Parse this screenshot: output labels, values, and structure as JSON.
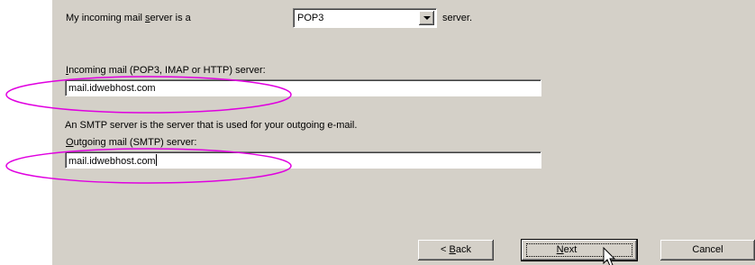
{
  "server_type_row": {
    "prefix": "My incoming mail ",
    "prefix_ul": "s",
    "prefix_rest": "erver is a",
    "selected": "POP3",
    "suffix": "server."
  },
  "incoming": {
    "label_ul": "I",
    "label_rest": "ncoming mail (POP3, IMAP or HTTP) server:",
    "value": "mail.idwebhost.com"
  },
  "smtp_note": "An SMTP server is the server that is used for your outgoing e-mail.",
  "outgoing": {
    "label_ul": "O",
    "label_rest": "utgoing mail (SMTP) server:",
    "value": "mail.idwebhost.com"
  },
  "buttons": {
    "back_prefix": "< ",
    "back_ul": "B",
    "back_rest": "ack",
    "next_ul": "N",
    "next_rest": "ext",
    "cancel": "Cancel"
  },
  "annotation_color": "#e000e0",
  "icons": [
    "dropdown-arrow-icon",
    "mouse-pointer-icon"
  ]
}
